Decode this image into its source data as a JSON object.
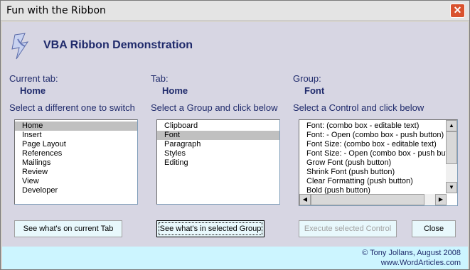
{
  "window": {
    "title": "Fun with the Ribbon",
    "close_glyph": "✕"
  },
  "header": {
    "heading": "VBA Ribbon Demonstration",
    "logo_icon": "ribbon-lightning-icon"
  },
  "tabs_section": {
    "label": "Current tab:",
    "value": "Home",
    "instruction": "Select a different one to switch",
    "items": [
      "Home",
      "Insert",
      "Page Layout",
      "References",
      "Mailings",
      "Review",
      "View",
      "Developer"
    ],
    "selected_index": 0
  },
  "groups_section": {
    "label": "Tab:",
    "value": "Home",
    "instruction": "Select a Group and click below",
    "items": [
      "Clipboard",
      "Font",
      "Paragraph",
      "Styles",
      "Editing"
    ],
    "selected_index": 1
  },
  "controls_section": {
    "label": "Group:",
    "value": "Font",
    "instruction": "Select a Control and click below",
    "items": [
      "Font: (combo box - editable text)",
      "Font: - Open (combo box - push button)",
      "Font Size: (combo box - editable text)",
      "Font Size: - Open (combo box - push button)",
      "Grow Font (push button)",
      "Shrink Font (push button)",
      "Clear Formatting (push button)",
      "Bold (push button)"
    ]
  },
  "buttons": {
    "tab": "See what's on current Tab",
    "group": "See what's in selected Group",
    "control": "Execute selected Control",
    "close": "Close"
  },
  "footer": {
    "copyright": "© Tony Jollans, August 2008",
    "website": "www.WordArticles.com"
  },
  "colors": {
    "client_bg": "#d7d6e3",
    "footer_bg": "#ccf5ff",
    "text_blue": "#1f2a6b",
    "button_bg": "#e8f8fc",
    "close_red": "#d9522e"
  }
}
